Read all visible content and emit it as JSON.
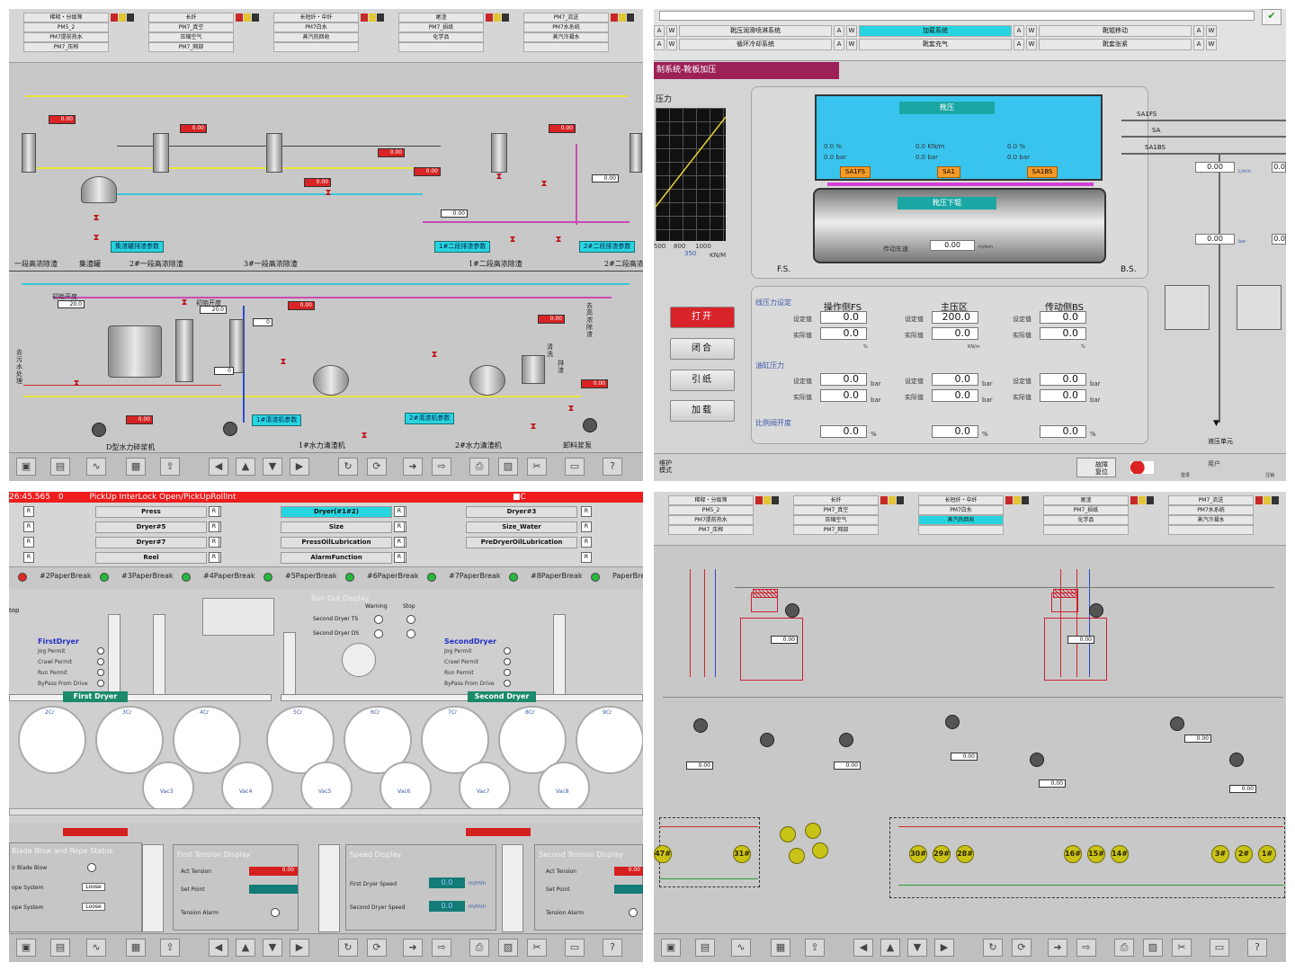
{
  "q1": {
    "nav": [
      [
        "稀释・分级筛",
        "PM5_2",
        "PM7提前热水",
        "PM7_压榨"
      ],
      [
        "长纤",
        "PM7_真空",
        "压缩空气",
        "PM7_网部"
      ],
      [
        "长短纤・中纤",
        "PM7白水",
        "蒸汽热回收",
        ""
      ],
      [
        "尾渣",
        "PM7_损纸",
        "化学品",
        ""
      ],
      [
        "PM7_流送",
        "PM7水系统",
        "蒸汽冷凝水",
        ""
      ]
    ],
    "buttons": [
      "集渣罐排渣参数",
      "1#二段排渣参数",
      "2#二段排渣参数",
      "1#清渣机参数",
      "2#清渣机参数"
    ],
    "section_labels": [
      "一段高浓除渣",
      "集渣罐",
      "2#一段高浓除渣",
      "3#一段高浓除渣",
      "1#二段高浓除渣",
      "2#二段高浓"
    ],
    "bottom_labels": [
      "D型水力碎浆机",
      "1#水力清渣机",
      "2#水力清渣机",
      "卸料浆泵"
    ],
    "side_labels": [
      "初始开度",
      "初始开度",
      "去污水处理",
      "去高浓除渣",
      "清洗",
      "排渣"
    ],
    "values": [
      "0.00",
      "20.0",
      "20.0",
      "0",
      "0"
    ]
  },
  "q2": {
    "nav_row1": [
      "A",
      "W",
      "靴压润滑喷淋系统",
      "A",
      "W",
      "加载系统",
      "A",
      "W",
      "靴辊移动",
      "A",
      "W"
    ],
    "nav_row2": [
      "A",
      "W",
      "循环冷却系统",
      "A",
      "W",
      "靴套充气",
      "A",
      "W",
      "靴套张紧",
      "A",
      "W"
    ],
    "banner": "制系统-靴板加压",
    "pressure_label": "压力",
    "axis": [
      "500",
      "800",
      "1000",
      "350",
      "KN/M"
    ],
    "shoe_press": "靴压",
    "lower_roll": "靴压下辊",
    "sa_labels": [
      "SA1FS",
      "SA1",
      "SA1BS"
    ],
    "right_tags": [
      "SA1FS",
      "SA",
      "SA1BS"
    ],
    "readings": [
      "0.0",
      "%",
      "0.0",
      "bar",
      "0.0",
      "KN/m",
      "0.0",
      "bar",
      "0.0",
      "%",
      "0.0",
      "bar"
    ],
    "drive_speed": "传动车速",
    "speed_value": "0.00",
    "speed_unit": "m/min",
    "fs": "F.S.",
    "bs": "B.S.",
    "side_values": [
      "0.00",
      "0.00",
      "0.0",
      "0.0"
    ],
    "units": [
      "L/min",
      "bar"
    ],
    "hydraulic": "液压单元",
    "commands": [
      "打开",
      "闭合",
      "引纸",
      "加载"
    ],
    "linear_pressure": "线压力设定",
    "oil_pressure": "油缸压力",
    "valve_open": "比例阀开度",
    "col_heads": [
      "操作侧FS",
      "主压区",
      "传动侧BS"
    ],
    "setpoint": "设定值",
    "actual": "实际值",
    "linear_values": [
      "0.0",
      "0.0",
      "200.0",
      "0.0",
      "0.0",
      "0.0"
    ],
    "linear_units": [
      "%",
      "KN/m",
      "%"
    ],
    "oil_values": [
      "0.0",
      "0.0",
      "0.0",
      "0.0",
      "0.0",
      "0.0"
    ],
    "oil_unit": "bar",
    "valve_values": [
      "0.0",
      "0.0",
      "0.0"
    ],
    "valve_unit": "%",
    "footer": [
      "维护模式",
      "故障复位",
      "用户",
      "注销",
      "登录"
    ]
  },
  "q3": {
    "alarm_time": "26:45.565",
    "alarm_code": "0",
    "alarm_text": "PickUp InterLock Open/PickUpRollInt",
    "alarm_right": "■C",
    "nav": [
      [
        "Press",
        "Dryer#5",
        "Dryer#7",
        "Reel"
      ],
      [
        "Dryer(#1#2)",
        "Size",
        "PressOilLubrication",
        "AlarmFunction"
      ],
      [
        "Dryer#3",
        "Size_Water",
        "PreDryerOilLubrication",
        ""
      ]
    ],
    "breaks": [
      "#2PaperBreak",
      "#3PaperBreak",
      "#4PaperBreak",
      "#5PaperBreak",
      "#6PaperBreak",
      "#7PaperBreak",
      "#8PaperBreak",
      "PaperBrea"
    ],
    "runout_title": "Run Out Display",
    "runout_cols": [
      "Warning",
      "Stop"
    ],
    "runout_rows": [
      "Second Dryer TS",
      "Second Dryer DS"
    ],
    "first_dryer_title": "FirstDryer",
    "second_dryer_title": "SecondDryer",
    "permits": [
      "Jog Permit",
      "Crawl Permit",
      "Run Permit",
      "ByPass From Drive"
    ],
    "first_dryer": "First Dryer",
    "second_dryer": "Second Dryer",
    "cylinders": [
      "2Cr",
      "3Cr",
      "4Cr",
      "5Cr",
      "6Cr",
      "7Cr",
      "8Cr",
      "9Cr"
    ],
    "vacs": [
      "Vac3",
      "Vac4",
      "Vac5",
      "Vac6",
      "Vac7",
      "Vac8"
    ],
    "blade_title": "Blade Blow and Rope Status",
    "blade_rows": [
      "ir Blade Blow",
      "ope System",
      "ope System"
    ],
    "loose": "Loose",
    "tension1_title": "First Tension Display",
    "tension2_title": "Second Tension Display",
    "tension_rows": [
      "Act Tension",
      "Set Point",
      "Tension Alarm"
    ],
    "speed_title": "Speed Display",
    "speed_rows": [
      "First Dryer Speed",
      "Second Dryer Speed"
    ],
    "speed_values": [
      "0.0",
      "0.0"
    ],
    "speed_unit": "m/min",
    "tension_value": "0.00",
    "top_label": "top"
  },
  "q4": {
    "nav": [
      [
        "稀释・分级筛",
        "PM5_2",
        "PM7提前热水",
        "PM7_压榨"
      ],
      [
        "长纤",
        "PM7_真空",
        "压缩空气",
        "PM7_网部"
      ],
      [
        "长短纤・中纤",
        "PM7白水",
        "蒸汽热回收",
        ""
      ],
      [
        "尾渣",
        "PM7_损纸",
        "化学品",
        ""
      ],
      [
        "PM7_流送",
        "PM7水系统",
        "蒸汽冷凝水",
        ""
      ]
    ],
    "circles": [
      "47#",
      "31#",
      "30#",
      "29#",
      "28#",
      "16#",
      "15#",
      "14#",
      "3#",
      "2#",
      "1#"
    ],
    "readouts": [
      "0.00",
      "0.00",
      "0.00",
      "0.00",
      "0.00",
      "0.00",
      "0.00",
      "0.00"
    ]
  },
  "toolbar_icons": [
    "folder-icon",
    "report-icon",
    "trend-icon",
    "list-icon",
    "export-icon",
    "left-icon",
    "up-icon",
    "down-icon",
    "right-icon",
    "refresh-icon",
    "reload-icon",
    "send-icon",
    "forward-icon",
    "print-icon",
    "save-icon",
    "tool-icon",
    "display-icon",
    "help-icon"
  ],
  "colors": {
    "alarm": "#ee1c1c",
    "cyan_button": "#27d5e0",
    "valve_red": "#c0151e",
    "banner": "#9c2157",
    "teal": "#1aa7a3"
  }
}
